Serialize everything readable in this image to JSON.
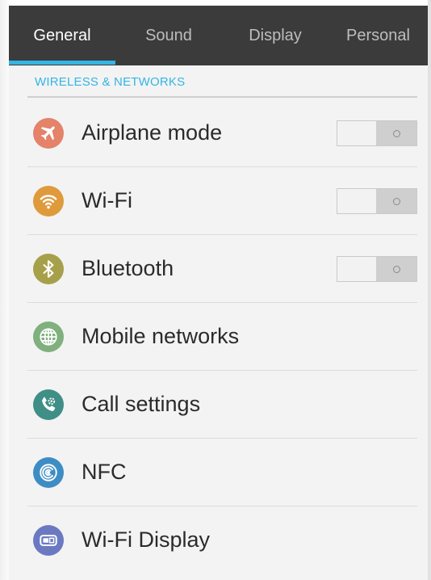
{
  "tabs": [
    {
      "label": "General",
      "active": true
    },
    {
      "label": "Sound",
      "active": false
    },
    {
      "label": "Display",
      "active": false
    },
    {
      "label": "Personal",
      "active": false
    }
  ],
  "section": {
    "header": "WIRELESS & NETWORKS"
  },
  "items": [
    {
      "label": "Airplane mode",
      "icon": "airplane-icon",
      "color": "#e4826a",
      "toggle": "off"
    },
    {
      "label": "Wi-Fi",
      "icon": "wifi-icon",
      "color": "#df9a3c",
      "toggle": "off"
    },
    {
      "label": "Bluetooth",
      "icon": "bluetooth-icon",
      "color": "#a6a04a",
      "toggle": "off"
    },
    {
      "label": "Mobile networks",
      "icon": "globe-icon",
      "color": "#7fb07e"
    },
    {
      "label": "Call settings",
      "icon": "phone-gear-icon",
      "color": "#3f8f86"
    },
    {
      "label": "NFC",
      "icon": "nfc-icon",
      "color": "#3d8dc4"
    },
    {
      "label": "Wi-Fi Display",
      "icon": "wifi-display-icon",
      "color": "#6b79c2"
    }
  ],
  "colors": {
    "tabbar": "#3b3b3b",
    "accent": "#33b5e5",
    "background": "#f3f3f3"
  }
}
